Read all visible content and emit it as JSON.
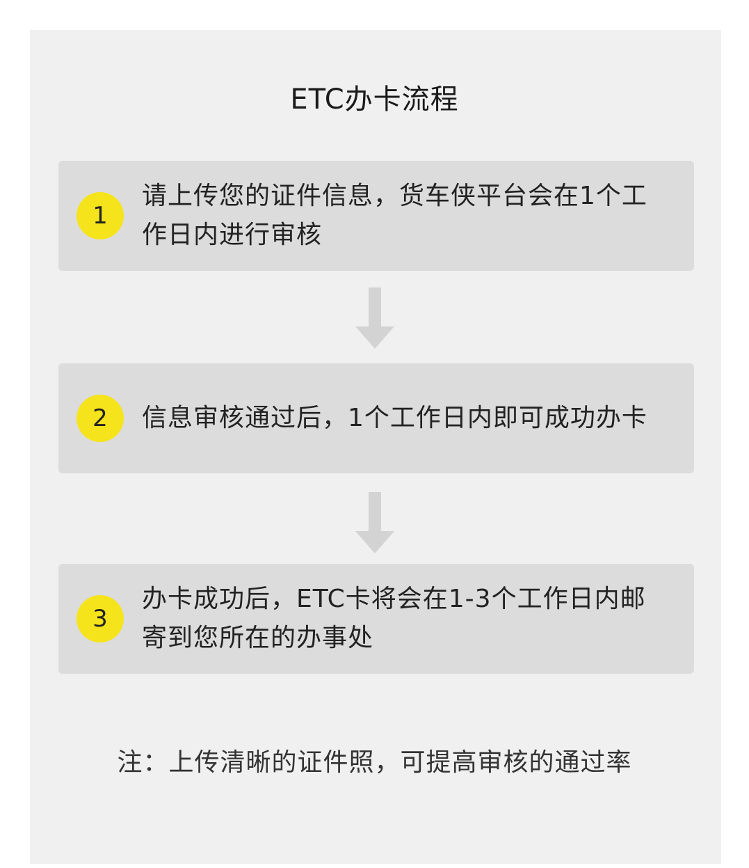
{
  "title": "ETC办卡流程",
  "steps": [
    {
      "number": "1",
      "text": "请上传您的证件信息，货车侠平台会在1个工作日内进行审核"
    },
    {
      "number": "2",
      "text": "信息审核通过后，1个工作日内即可成功办卡"
    },
    {
      "number": "3",
      "text": "办卡成功后，ETC卡将会在1-3个工作日内邮寄到您所在的办事处"
    }
  ],
  "note": "注：上传清晰的证件照，可提高审核的通过率",
  "colors": {
    "badge": "#f5e41c",
    "step_bg": "#dcdcdc",
    "panel_bg": "#f0f0f0",
    "arrow": "#d3d3d3"
  }
}
